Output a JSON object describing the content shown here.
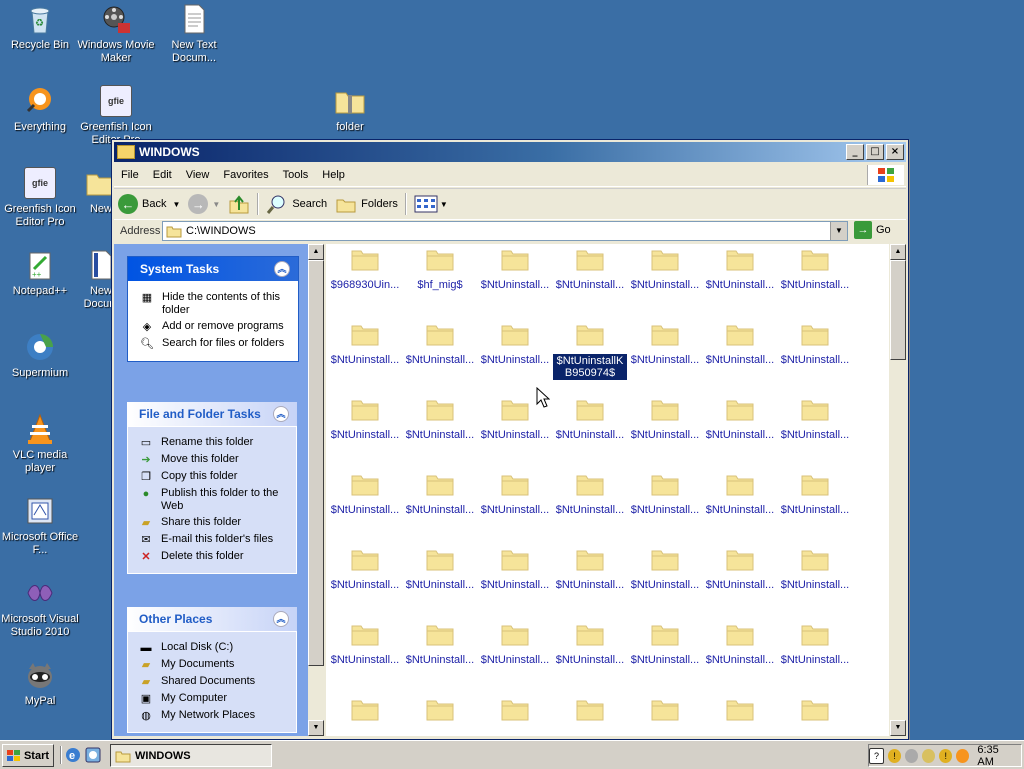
{
  "desktop": {
    "icons": [
      {
        "label": "Recycle Bin",
        "icon": "recycle-bin-icon"
      },
      {
        "label": "Windows Movie Maker",
        "icon": "movie-maker-icon"
      },
      {
        "label": "New Text Docum...",
        "icon": "text-document-icon"
      },
      {
        "label": "Everything",
        "icon": "everything-icon"
      },
      {
        "label": "Greenfish Icon Editor Pro",
        "icon": "greenfish-icon"
      },
      {
        "label": "folder",
        "icon": "zip-folder-icon"
      },
      {
        "label": "Greenfish Icon Editor Pro",
        "icon": "greenfish-icon"
      },
      {
        "label": "New",
        "icon": "folder-icon"
      },
      {
        "label": "Notepad++",
        "icon": "notepadpp-icon"
      },
      {
        "label": "New Docum",
        "icon": "document-icon"
      },
      {
        "label": "Supermium",
        "icon": "supermium-icon"
      },
      {
        "label": "VLC media player",
        "icon": "vlc-icon"
      },
      {
        "label": "Microsoft Office F...",
        "icon": "office-icon"
      },
      {
        "label": "Microsoft Visual Studio 2010",
        "icon": "visual-studio-icon"
      },
      {
        "label": "MyPal",
        "icon": "mypal-icon"
      }
    ]
  },
  "window": {
    "title": "WINDOWS",
    "menu": [
      "File",
      "Edit",
      "View",
      "Favorites",
      "Tools",
      "Help"
    ],
    "toolbar": {
      "back": "Back",
      "search": "Search",
      "folders": "Folders"
    },
    "address": {
      "label": "Address",
      "value": "C:\\WINDOWS",
      "go": "Go"
    },
    "system_tasks": {
      "title": "System Tasks",
      "items": [
        {
          "label": "Hide the contents of this folder",
          "icon": "hide-contents-icon"
        },
        {
          "label": "Add or remove programs",
          "icon": "add-remove-programs-icon"
        },
        {
          "label": "Search for files or folders",
          "icon": "search-icon"
        }
      ]
    },
    "file_folder_tasks": {
      "title": "File and Folder Tasks",
      "items": [
        {
          "label": "Rename this folder",
          "icon": "rename-icon"
        },
        {
          "label": "Move this folder",
          "icon": "move-icon"
        },
        {
          "label": "Copy this folder",
          "icon": "copy-icon"
        },
        {
          "label": "Publish this folder to the Web",
          "icon": "publish-web-icon"
        },
        {
          "label": "Share this folder",
          "icon": "share-icon"
        },
        {
          "label": "E-mail this folder's files",
          "icon": "email-icon"
        },
        {
          "label": "Delete this folder",
          "icon": "delete-icon"
        }
      ]
    },
    "other_places": {
      "title": "Other Places",
      "items": [
        {
          "label": "Local Disk (C:)",
          "icon": "local-disk-icon"
        },
        {
          "label": "My Documents",
          "icon": "my-documents-icon"
        },
        {
          "label": "Shared Documents",
          "icon": "shared-documents-icon"
        },
        {
          "label": "My Computer",
          "icon": "my-computer-icon"
        },
        {
          "label": "My Network Places",
          "icon": "network-places-icon"
        }
      ]
    },
    "folders": [
      "$968930Uin...",
      "$hf_mig$",
      "$NtUninstall...",
      "$NtUninstall...",
      "$NtUninstall...",
      "$NtUninstall...",
      "$NtUninstall...",
      "$NtUninstall...",
      "$NtUninstall...",
      "$NtUninstall...",
      "$NtUninstallKB950974$",
      "$NtUninstall...",
      "$NtUninstall...",
      "$NtUninstall...",
      "$NtUninstall...",
      "$NtUninstall...",
      "$NtUninstall...",
      "$NtUninstall...",
      "$NtUninstall...",
      "$NtUninstall...",
      "$NtUninstall...",
      "$NtUninstall...",
      "$NtUninstall...",
      "$NtUninstall...",
      "$NtUninstall...",
      "$NtUninstall...",
      "$NtUninstall...",
      "$NtUninstall...",
      "$NtUninstall...",
      "$NtUninstall...",
      "$NtUninstall...",
      "$NtUninstall...",
      "$NtUninstall...",
      "$NtUninstall...",
      "$NtUninstall...",
      "$NtUninstall...",
      "$NtUninstall...",
      "$NtUninstall...",
      "$NtUninstall...",
      "$NtUninstall...",
      "$NtUninstall...",
      "$NtUninstall...",
      "",
      "",
      "",
      "",
      "",
      "",
      ""
    ],
    "selected_folder": "$NtUninstallKB950974$",
    "folder_color": "#F6E49A",
    "selection_color": "#0A246A"
  },
  "taskbar": {
    "start": "Start",
    "window_button": "WINDOWS",
    "clock": "6:35 AM"
  }
}
